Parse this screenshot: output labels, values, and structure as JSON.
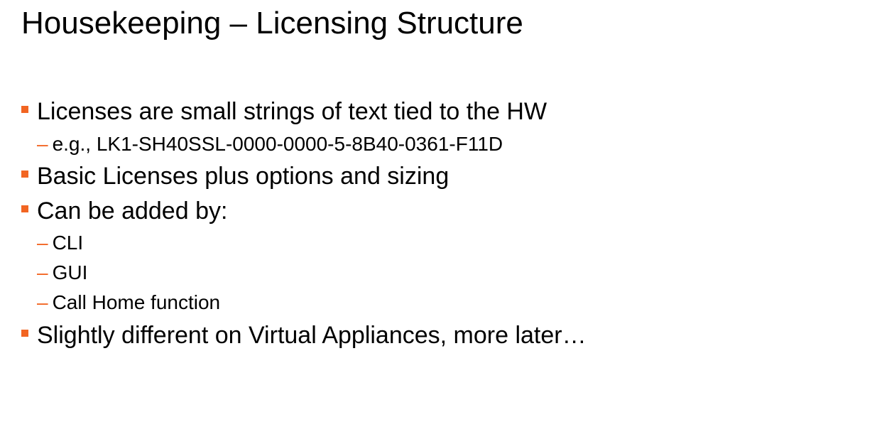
{
  "slide": {
    "title": "Housekeeping – Licensing Structure",
    "bullets": {
      "b1": "Licenses are small strings of text tied to the HW",
      "b1_sub1": "e.g., LK1-SH40SSL-0000-0000-5-8B40-0361-F11D",
      "b2": "Basic Licenses plus options and sizing",
      "b3": "Can be added by:",
      "b3_sub1": "CLI",
      "b3_sub2": "GUI",
      "b3_sub3": "Call Home function",
      "b4": "Slightly different on Virtual Appliances, more later…"
    },
    "dash_glyph": "–",
    "accent_color": "#f26522"
  }
}
